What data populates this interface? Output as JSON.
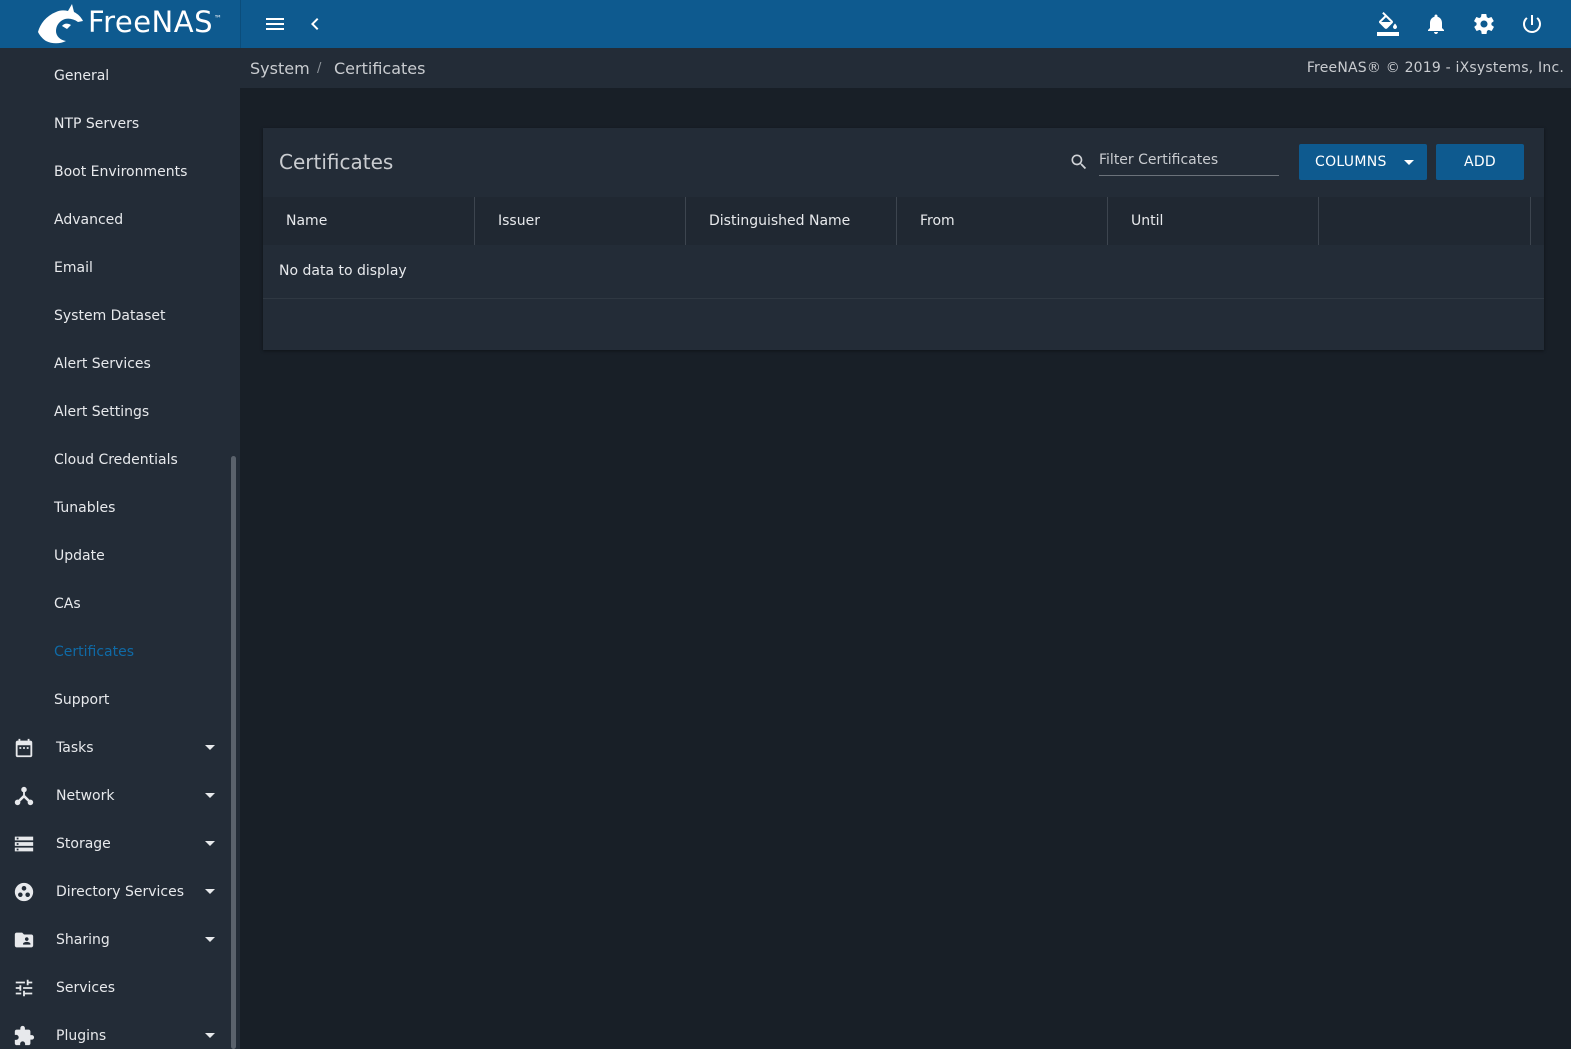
{
  "topbar": {
    "brand": "FreeNAS",
    "trademark": "™",
    "icons": {
      "menu": "menu-icon",
      "collapse": "chevron-left-icon",
      "theme": "paint-bucket-icon",
      "notifications": "bell-icon",
      "settings": "gear-icon",
      "power": "power-icon"
    }
  },
  "breadcrumb": {
    "parent": "System",
    "separator": "/",
    "current": "Certificates",
    "copyright": "FreeNAS® © 2019 - iXsystems, Inc."
  },
  "sidebar": {
    "sub_items": [
      {
        "label": "General",
        "active": false
      },
      {
        "label": "NTP Servers",
        "active": false
      },
      {
        "label": "Boot Environments",
        "active": false
      },
      {
        "label": "Advanced",
        "active": false
      },
      {
        "label": "Email",
        "active": false
      },
      {
        "label": "System Dataset",
        "active": false
      },
      {
        "label": "Alert Services",
        "active": false
      },
      {
        "label": "Alert Settings",
        "active": false
      },
      {
        "label": "Cloud Credentials",
        "active": false
      },
      {
        "label": "Tunables",
        "active": false
      },
      {
        "label": "Update",
        "active": false
      },
      {
        "label": "CAs",
        "active": false
      },
      {
        "label": "Certificates",
        "active": true
      },
      {
        "label": "Support",
        "active": false
      }
    ],
    "main_items": [
      {
        "label": "Tasks",
        "icon": "calendar-icon",
        "expandable": true
      },
      {
        "label": "Network",
        "icon": "network-icon",
        "expandable": true
      },
      {
        "label": "Storage",
        "icon": "storage-icon",
        "expandable": true
      },
      {
        "label": "Directory Services",
        "icon": "directory-icon",
        "expandable": true
      },
      {
        "label": "Sharing",
        "icon": "folder-shared-icon",
        "expandable": true
      },
      {
        "label": "Services",
        "icon": "tune-icon",
        "expandable": false
      },
      {
        "label": "Plugins",
        "icon": "puzzle-icon",
        "expandable": true
      }
    ]
  },
  "card": {
    "title": "Certificates",
    "filter_placeholder": "Filter Certificates",
    "filter_value": "",
    "columns_label": "COLUMNS",
    "add_label": "ADD",
    "columns": [
      "Name",
      "Issuer",
      "Distinguished Name",
      "From",
      "Until",
      ""
    ],
    "empty_message": "No data to display"
  },
  "colors": {
    "topbar": "#0e5a8f",
    "sidebar": "#232c37",
    "background": "#181f27",
    "active_link": "#0f6aa6"
  }
}
